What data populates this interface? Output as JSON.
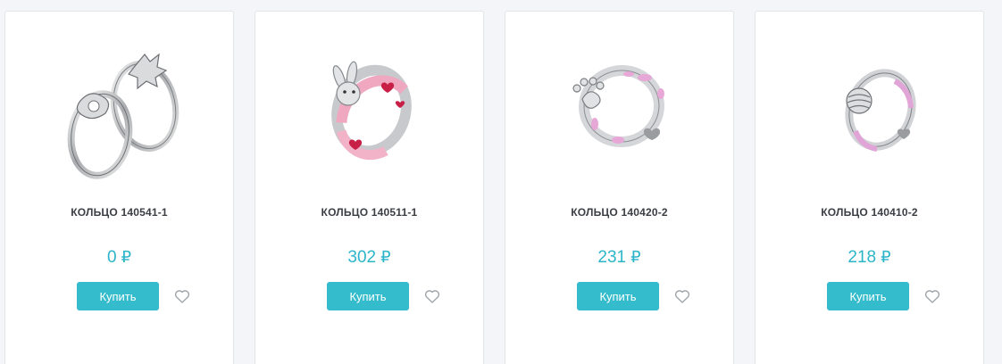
{
  "products": [
    {
      "title": "КОЛЬЦО 140541-1",
      "price": "0",
      "currency": "₽",
      "buy_label": "Купить",
      "image": "silver-rings-pair-photo"
    },
    {
      "title": "КОЛЬЦО 140511-1",
      "price": "302",
      "currency": "₽",
      "buy_label": "Купить",
      "image": "pink-bunny-ring-photo"
    },
    {
      "title": "КОЛЬЦО 140420-2",
      "price": "231",
      "currency": "₽",
      "buy_label": "Купить",
      "image": "paw-print-ring-photo"
    },
    {
      "title": "КОЛЬЦО 140410-2",
      "price": "218",
      "currency": "₽",
      "buy_label": "Купить",
      "image": "ball-ring-photo"
    }
  ],
  "colors": {
    "accent": "#34bccc",
    "price": "#2cb5c9",
    "title": "#3a3d44",
    "background": "#f3f5f8"
  },
  "icons": {
    "favorite": "heart-outline-icon"
  }
}
